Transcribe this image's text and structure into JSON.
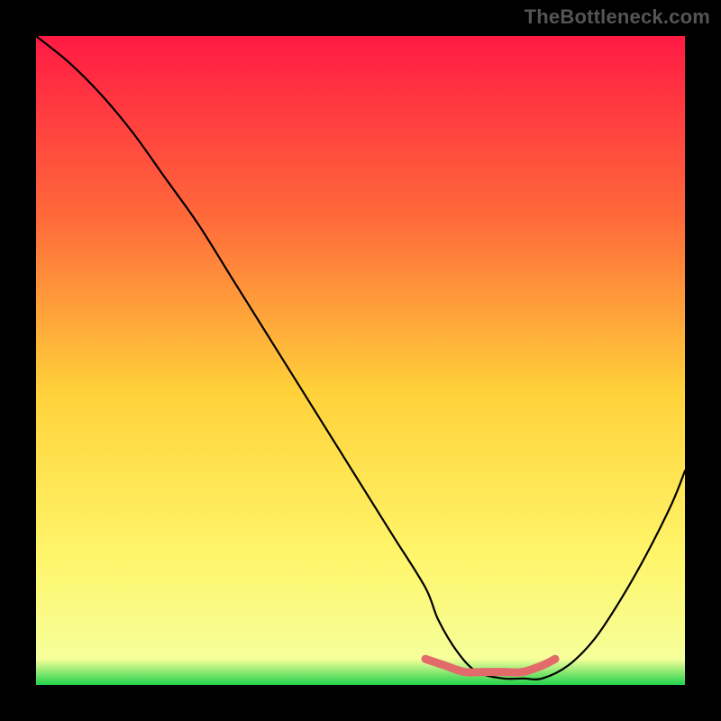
{
  "watermark": "TheBottleneck.com",
  "colors": {
    "top": "#ff1a44",
    "upper_mid": "#ff6a3a",
    "mid": "#ffd23a",
    "lower_mid": "#fff56a",
    "bottom_green": "#22d24b",
    "accent_pink": "#e26a6a",
    "curve": "#000000",
    "background": "#000000"
  },
  "chart_data": {
    "type": "line",
    "title": "",
    "xlabel": "",
    "ylabel": "",
    "xlim": [
      0,
      100
    ],
    "ylim": [
      0,
      100
    ],
    "series": [
      {
        "name": "bottleneck-curve",
        "x": [
          0,
          5,
          10,
          15,
          20,
          25,
          30,
          35,
          40,
          45,
          50,
          55,
          60,
          62,
          65,
          68,
          72,
          75,
          78,
          82,
          86,
          90,
          94,
          98,
          100
        ],
        "values": [
          100,
          96,
          91,
          85,
          78,
          71,
          63,
          55,
          47,
          39,
          31,
          23,
          15,
          10,
          5,
          2,
          1,
          1,
          1,
          3,
          7,
          13,
          20,
          28,
          33
        ]
      },
      {
        "name": "optimal-band",
        "x": [
          60,
          63,
          66,
          69,
          72,
          75,
          78,
          80
        ],
        "values": [
          4,
          3,
          2,
          2,
          2,
          2,
          3,
          4
        ]
      }
    ],
    "annotations": []
  }
}
